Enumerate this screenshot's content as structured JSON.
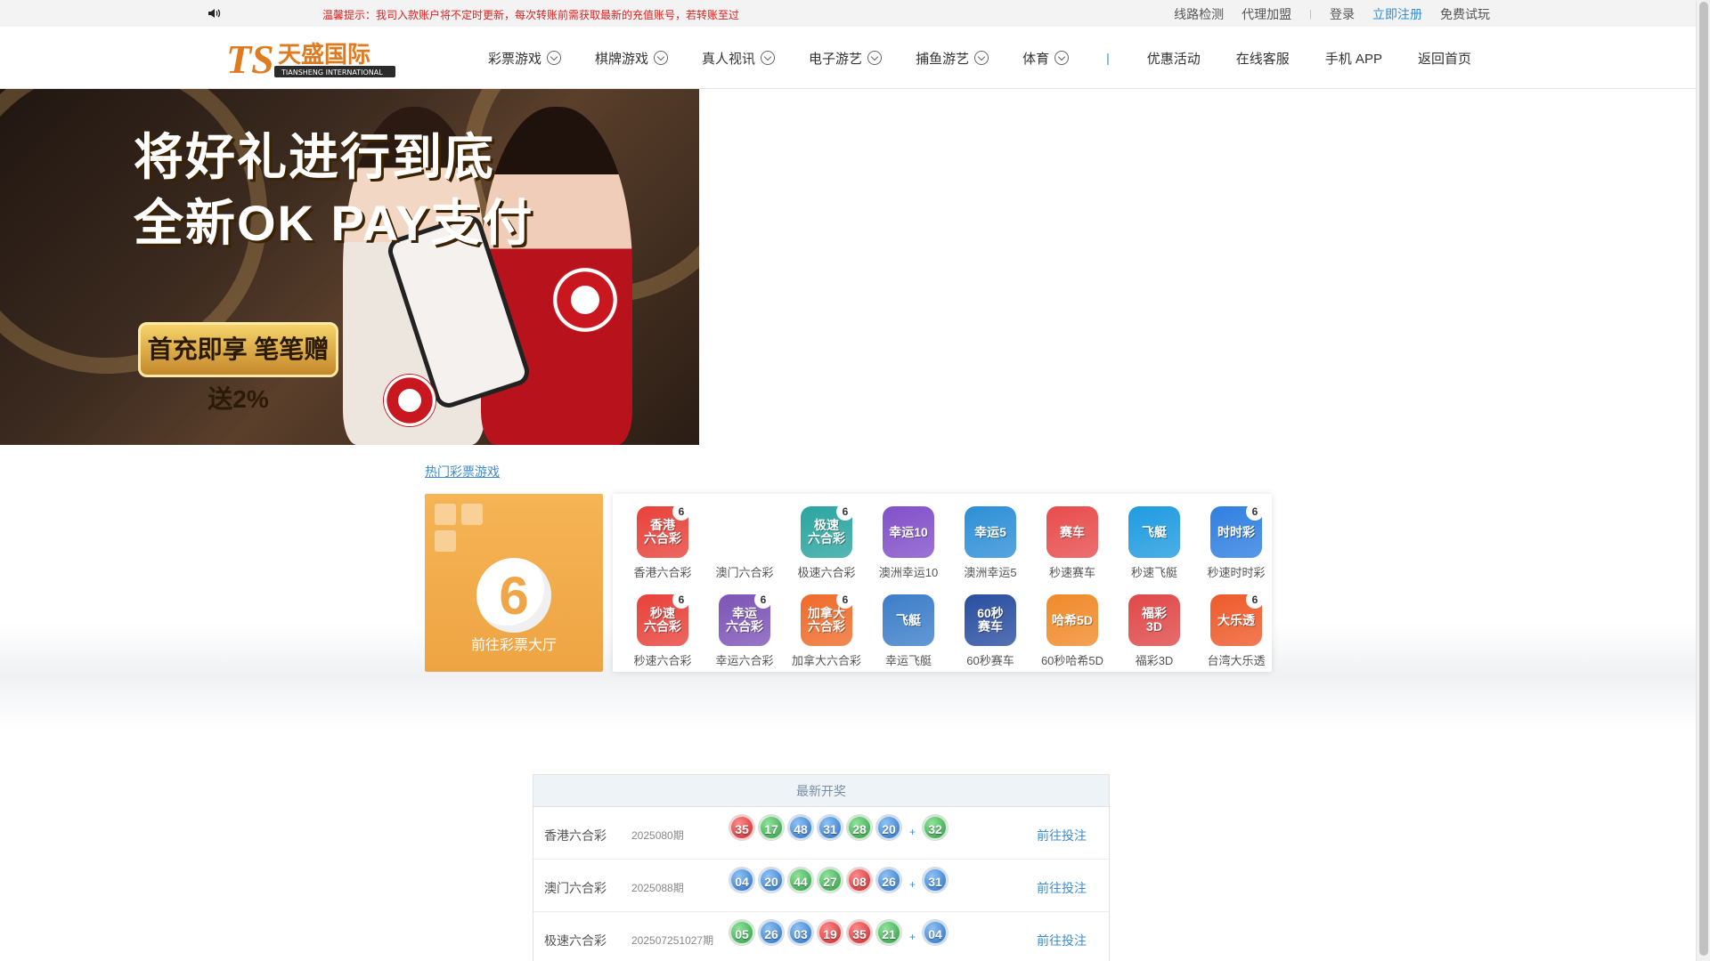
{
  "topbar": {
    "notice": "温馨提示：我司入款账户将不定时更新，每次转账前需获取最新的充值账号，若转账至过",
    "links": {
      "line_check": "线路检测",
      "agent": "代理加盟",
      "login": "登录",
      "register": "立即注册",
      "free_trial": "免费试玩"
    }
  },
  "header": {
    "logo_text": "天盛国际",
    "logo_sub": "TIANSHENG INTERNATIONAL",
    "nav_dropdowns": [
      "彩票游戏",
      "棋牌游戏",
      "真人视讯",
      "电子游艺",
      "捕鱼游艺",
      "体育"
    ],
    "nav_divider": "|",
    "nav_links": [
      "优惠活动",
      "在线客服",
      "手机 APP",
      "返回首页"
    ]
  },
  "banner": {
    "headline_1": "将好礼进行到底",
    "headline_2": "全新OK PAY支付",
    "badge": "首充即享 笔笔赠送2%"
  },
  "hot_lottery": {
    "title": "热门彩票游戏",
    "hall_number": "6",
    "hall_label": "前往彩票大厅",
    "games": [
      {
        "label": "香港六合彩",
        "icon_text": "香港\n六合彩",
        "color": "#e8413a",
        "six": true
      },
      {
        "label": "澳门六合彩",
        "icon_text": "",
        "color": "",
        "six": false
      },
      {
        "label": "极速六合彩",
        "icon_text": "极速\n六合彩",
        "color": "#2ba5a0",
        "six": true
      },
      {
        "label": "澳洲幸运10",
        "icon_text": "幸运10",
        "color": "#8250c9",
        "six": false
      },
      {
        "label": "澳洲幸运5",
        "icon_text": "幸运5",
        "color": "#2d8fd6",
        "six": false
      },
      {
        "label": "秒速赛车",
        "icon_text": "赛车",
        "color": "#e74c4c",
        "six": false
      },
      {
        "label": "秒速飞艇",
        "icon_text": "飞艇",
        "color": "#1f9be0",
        "six": false
      },
      {
        "label": "秒速时时彩",
        "icon_text": "时时彩",
        "color": "#2f7fe0",
        "six": true
      },
      {
        "label": "秒速六合彩",
        "icon_text": "秒速\n六合彩",
        "color": "#e8413a",
        "six": true
      },
      {
        "label": "幸运六合彩",
        "icon_text": "幸运\n六合彩",
        "color": "#7d54b7",
        "six": true
      },
      {
        "label": "加拿大六合彩",
        "icon_text": "加拿大\n六合彩",
        "color": "#ef6b2a",
        "six": true
      },
      {
        "label": "幸运飞艇",
        "icon_text": "飞艇",
        "color": "#3d7ec9",
        "six": false
      },
      {
        "label": "60秒赛车",
        "icon_text": "60秒\n赛车",
        "color": "#2a4ea0",
        "six": false
      },
      {
        "label": "60秒哈希5D",
        "icon_text": "哈希5D",
        "color": "#f08a2a",
        "six": false
      },
      {
        "label": "福彩3D",
        "icon_text": "福彩\n3D",
        "color": "#e04848",
        "six": false
      },
      {
        "label": "台湾大乐透",
        "icon_text": "大乐透",
        "color": "#ee5a2a",
        "six": true
      }
    ]
  },
  "latest_draws": {
    "title": "最新开奖",
    "plus": "+",
    "bet_label": "前往投注",
    "rows": [
      {
        "name": "香港六合彩",
        "period": "2025080期",
        "numbers": [
          "35",
          "17",
          "48",
          "31",
          "28",
          "20"
        ],
        "special": "32",
        "colors": [
          "red",
          "green",
          "blue",
          "blue",
          "green",
          "blue"
        ],
        "special_color": "green"
      },
      {
        "name": "澳门六合彩",
        "period": "2025088期",
        "numbers": [
          "04",
          "20",
          "44",
          "27",
          "08",
          "26"
        ],
        "special": "31",
        "colors": [
          "blue",
          "blue",
          "green",
          "green",
          "red",
          "blue"
        ],
        "special_color": "blue"
      },
      {
        "name": "极速六合彩",
        "period": "202507251027期",
        "numbers": [
          "05",
          "26",
          "03",
          "19",
          "35",
          "21"
        ],
        "special": "04",
        "colors": [
          "green",
          "blue",
          "blue",
          "red",
          "red",
          "green"
        ],
        "special_color": "blue"
      }
    ]
  }
}
